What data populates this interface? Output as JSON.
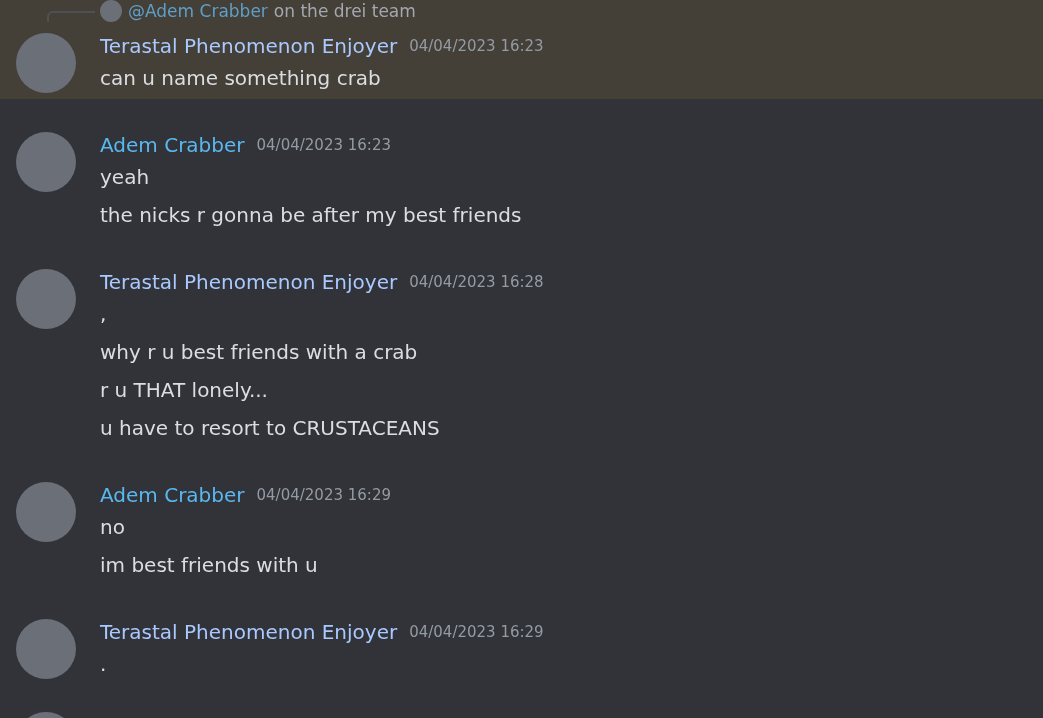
{
  "messages": [
    {
      "kind": "full",
      "author": "Terastal Phenomenon Enjoyer",
      "color": "#a9c9ff",
      "timestamp": "04/04/2023 16:23",
      "highlighted": true,
      "reply": {
        "mention": "@Adem Crabber",
        "color": "#5f9fc7",
        "text": "on the drei team"
      },
      "lines": [
        "can u name something crab"
      ]
    },
    {
      "kind": "full",
      "author": "Adem Crabber",
      "color": "#5ab8ef",
      "timestamp": "04/04/2023 16:23",
      "highlighted": false,
      "lines": [
        "yeah",
        "the nicks r gonna be after my best friends"
      ]
    },
    {
      "kind": "full",
      "author": "Terastal Phenomenon Enjoyer",
      "color": "#a9c9ff",
      "timestamp": "04/04/2023 16:28",
      "highlighted": false,
      "lines": [
        ",",
        "why r u best friends with a crab",
        "r u THAT lonely...",
        "u have to resort to CRUSTACEANS"
      ]
    },
    {
      "kind": "full",
      "author": "Adem Crabber",
      "color": "#5ab8ef",
      "timestamp": "04/04/2023 16:29",
      "highlighted": false,
      "lines": [
        "no",
        "im best friends with u"
      ]
    },
    {
      "kind": "full",
      "author": "Terastal Phenomenon Enjoyer",
      "color": "#a9c9ff",
      "timestamp": "04/04/2023 16:29",
      "highlighted": false,
      "lines": [
        "."
      ]
    },
    {
      "kind": "partial",
      "highlighted": false
    }
  ]
}
